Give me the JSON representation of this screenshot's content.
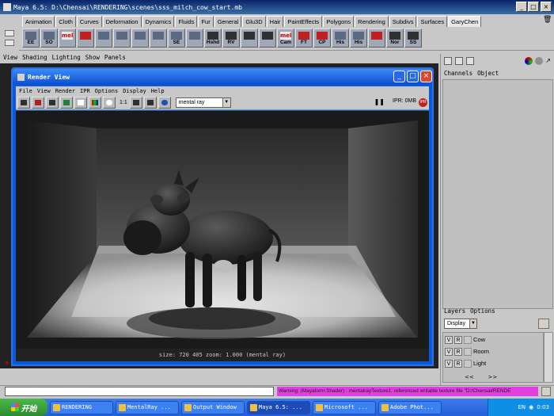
{
  "window": {
    "title": "Maya 6.5: D:\\Chensai\\RENDERING\\scenes\\sss_milch_cow_start.mb"
  },
  "shelf": {
    "tabs": [
      "Animation",
      "Cloth",
      "Curves",
      "Deformation",
      "Dynamics",
      "Fluids",
      "Fur",
      "General",
      "Glu3D",
      "Hair",
      "PaintEffects",
      "Polygons",
      "Rendering",
      "Subdivs",
      "Surfaces",
      "GaryChen"
    ],
    "selected_tab": "GaryChen",
    "icons": [
      {
        "label": "EE",
        "style": "normal"
      },
      {
        "label": "SO",
        "style": "normal"
      },
      {
        "label": "",
        "style": "normal",
        "text": "mel"
      },
      {
        "label": "",
        "style": "red"
      },
      {
        "label": "",
        "style": "normal"
      },
      {
        "label": "",
        "style": "normal"
      },
      {
        "label": "",
        "style": "normal"
      },
      {
        "label": "",
        "style": "normal"
      },
      {
        "label": "SE",
        "style": "normal"
      },
      {
        "label": "",
        "style": "normal"
      },
      {
        "label": "Hshd",
        "style": "dark"
      },
      {
        "label": "RV",
        "style": "dark"
      },
      {
        "label": "",
        "style": "dark"
      },
      {
        "label": "",
        "style": "dark"
      },
      {
        "label": "Cam",
        "style": "normal",
        "text": "mel"
      },
      {
        "label": "FT",
        "style": "red"
      },
      {
        "label": "CP",
        "style": "red"
      },
      {
        "label": "His",
        "style": "normal"
      },
      {
        "label": "His",
        "style": "normal"
      },
      {
        "label": "",
        "style": "red"
      },
      {
        "label": "Nor",
        "style": "dark"
      },
      {
        "label": "SS",
        "style": "dark"
      }
    ]
  },
  "panel_menu": [
    "View",
    "Shading",
    "Lighting",
    "Show",
    "Panels"
  ],
  "render_view": {
    "title": "Render View",
    "menu": [
      "File",
      "View",
      "Render",
      "IPR",
      "Options",
      "Display",
      "Help"
    ],
    "ratio_label": "1:1",
    "renderer": "mental ray",
    "ipr_status": "IPR: 0MB",
    "ipr_btn": "IPR",
    "status": "size:  720  405 zoom: 1.000  (mental ray)"
  },
  "channels": {
    "menu": [
      "Channels",
      "Object"
    ]
  },
  "layers": {
    "menu": [
      "Layers",
      "Options"
    ],
    "display_select": "Display",
    "items": [
      {
        "v": "V",
        "r": "R",
        "name": "Cow"
      },
      {
        "v": "V",
        "r": "R",
        "name": "Room"
      },
      {
        "v": "V",
        "r": "R",
        "name": "Light"
      }
    ]
  },
  "command": {
    "warning": "Warning: (Mayatomr.Shader) : mentalrayTexture1: referenced writable texture file \"D:/Chensai/RENDE"
  },
  "taskbar": {
    "start": "开始",
    "tasks": [
      {
        "label": "RENDERING",
        "active": false
      },
      {
        "label": "MentalRay ...",
        "active": false
      },
      {
        "label": "Output Window",
        "active": false
      },
      {
        "label": "Maya 6.5: ...",
        "active": true
      },
      {
        "label": "Microsoft ...",
        "active": false
      },
      {
        "label": "Adobe Phot...",
        "active": false
      }
    ],
    "lang": "EN",
    "clock": "0:03"
  },
  "colors": {
    "titlebar": "#0a246a",
    "xp_blue": "#245edb",
    "warning": "#e040e0"
  }
}
